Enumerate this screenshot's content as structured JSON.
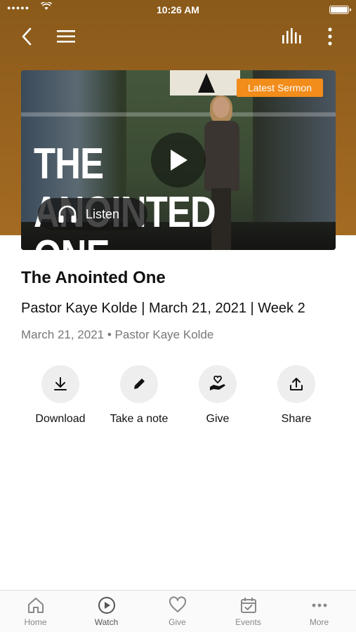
{
  "status": {
    "time": "10:26 AM",
    "signal": "●●●●●"
  },
  "hero": {
    "badge": "Latest Sermon",
    "overlay_line1": "THE",
    "overlay_line2": "ANOINTED ONE",
    "listen_label": "Listen"
  },
  "sermon": {
    "title": "The Anointed One",
    "subtitle": "Pastor Kaye Kolde | March 21, 2021 | Week 2",
    "meta": "March 21, 2021 • Pastor Kaye Kolde"
  },
  "actions": [
    {
      "label": "Download",
      "icon": "download-icon"
    },
    {
      "label": "Take a note",
      "icon": "pencil-icon"
    },
    {
      "label": "Give",
      "icon": "give-hand-heart-icon"
    },
    {
      "label": "Share",
      "icon": "share-icon"
    }
  ],
  "tabs": [
    {
      "label": "Home",
      "icon": "home-icon"
    },
    {
      "label": "Watch",
      "icon": "play-circle-icon"
    },
    {
      "label": "Give",
      "icon": "heart-icon"
    },
    {
      "label": "Events",
      "icon": "calendar-check-icon"
    },
    {
      "label": "More",
      "icon": "dots-icon"
    }
  ],
  "colors": {
    "header": "#9a6420",
    "badge": "#f28c1a",
    "action_bg": "#eeeeee"
  }
}
